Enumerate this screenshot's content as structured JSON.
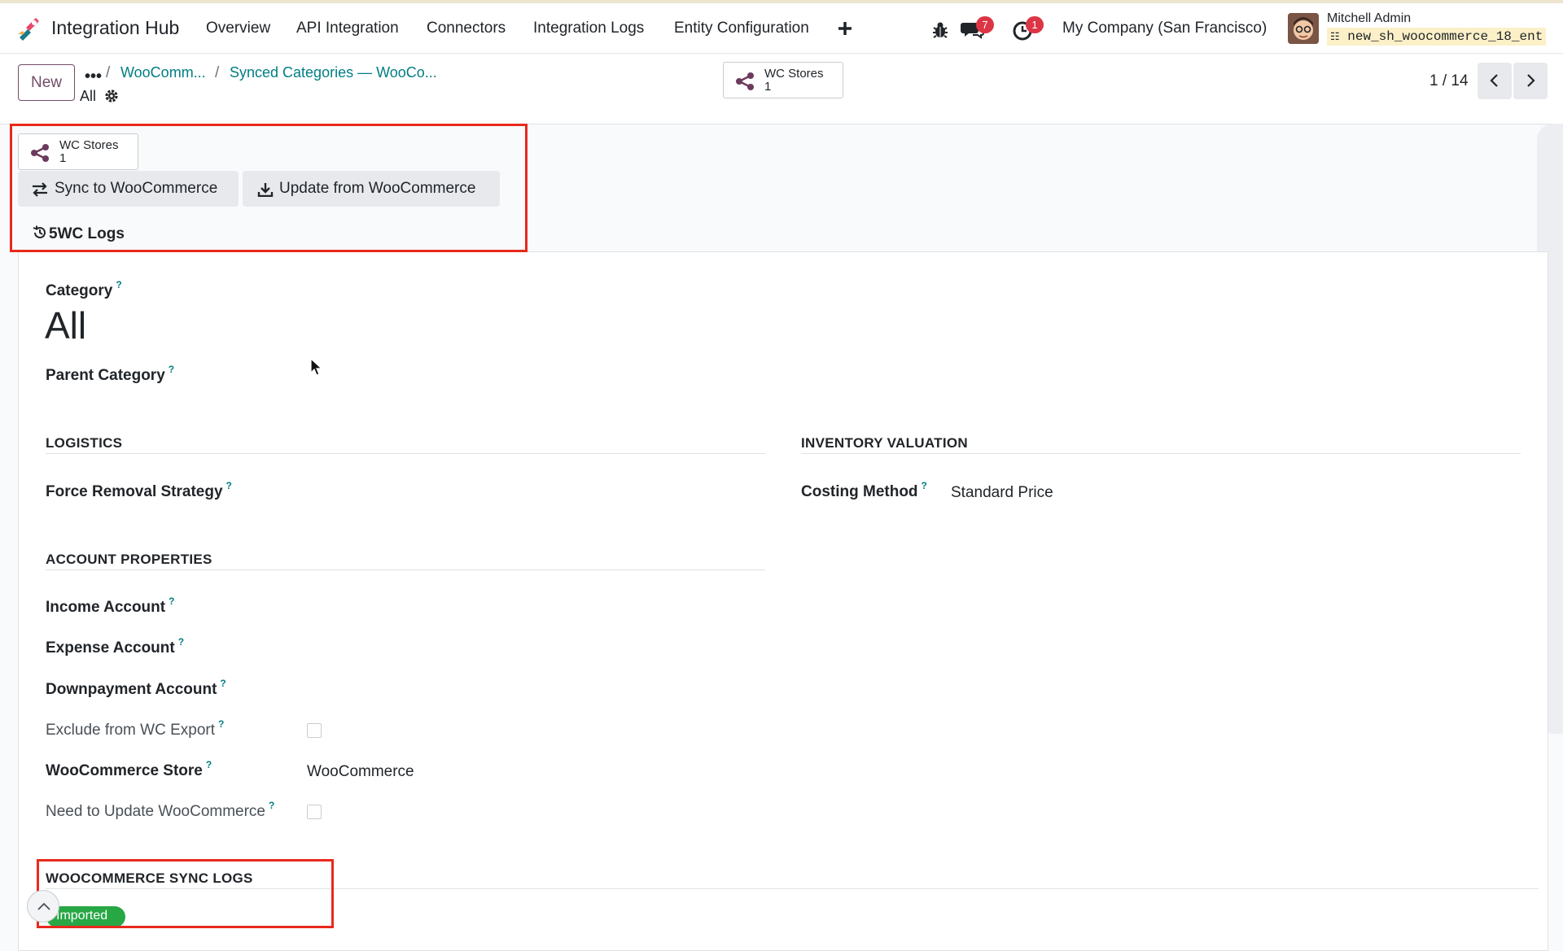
{
  "app": {
    "name": "Integration Hub",
    "menu": [
      "Overview",
      "API Integration",
      "Connectors",
      "Integration Logs",
      "Entity Configuration"
    ],
    "plus_icon": "plus-icon",
    "messages_badge": "7",
    "activities_badge": "1",
    "company": "My Company (San Francisco)",
    "user_name": "Mitchell Admin",
    "database": "new_sh_woocommerce_18_ent"
  },
  "control_panel": {
    "new_label": "New",
    "breadcrumb_dots": "•••",
    "breadcrumb_sep": "/",
    "breadcrumb_1": "WooComm...",
    "breadcrumb_2": "Synced Categories — WooCo...",
    "current_record": "All",
    "smart_button_label": "WC Stores",
    "smart_button_count": "1",
    "pager": "1 / 14"
  },
  "buttons": {
    "wc_stores_label": "WC Stores",
    "wc_stores_count": "1",
    "sync_to_wc": "Sync to WooCommerce",
    "update_from_wc": "Update from WooCommerce",
    "wc_logs": "5WC Logs"
  },
  "form": {
    "category_label": "Category",
    "category_value": "All",
    "parent_category_label": "Parent Category",
    "help_mark": "?",
    "logistics_title": "LOGISTICS",
    "force_removal_label": "Force Removal Strategy",
    "inventory_title": "INVENTORY VALUATION",
    "costing_method_label": "Costing Method",
    "costing_method_value": "Standard Price",
    "account_title": "ACCOUNT PROPERTIES",
    "income_account_label": "Income Account",
    "expense_account_label": "Expense Account",
    "downpayment_account_label": "Downpayment Account",
    "exclude_wc_export_label": "Exclude from WC Export",
    "exclude_wc_export_checked": false,
    "wc_store_label": "WooCommerce Store",
    "wc_store_value": "WooCommerce",
    "need_update_label": "Need to Update WooCommerce",
    "need_update_checked": false,
    "sync_logs_title": "WOOCOMMERCE SYNC LOGS",
    "sync_status_tag": "Imported"
  },
  "colors": {
    "brand": "#714b67",
    "link": "#017e84",
    "badge": "#dc3545",
    "highlight_box": "#e8291c",
    "imported_tag": "#28a745"
  }
}
